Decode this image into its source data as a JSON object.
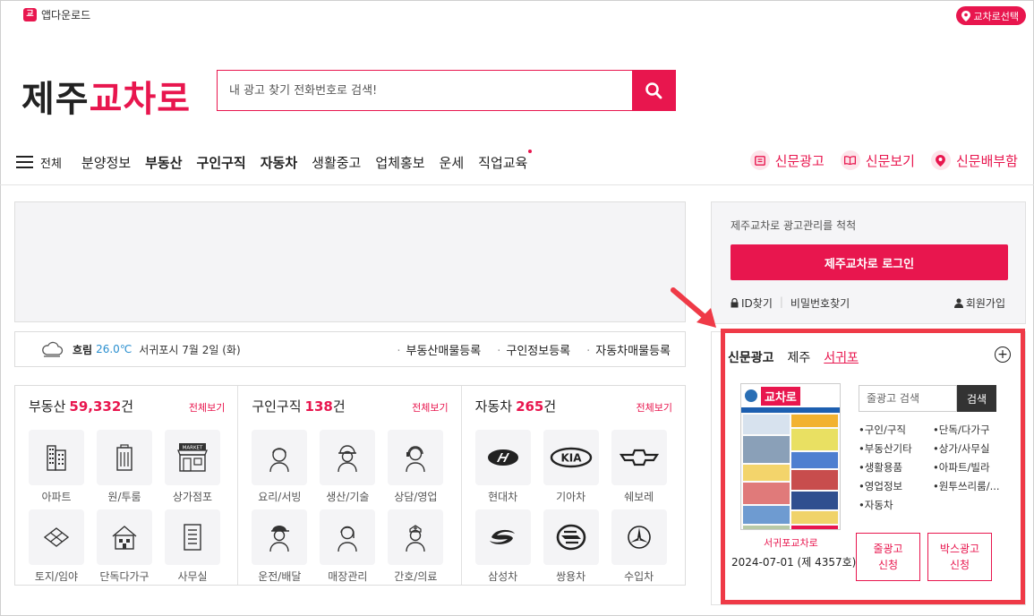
{
  "top": {
    "app_download": "앱다운로드",
    "region_select": "교차로선택"
  },
  "logo": {
    "part1": "제주",
    "part2": "교차로"
  },
  "search": {
    "placeholder": "내 광고 찾기 전화번호로 검색!"
  },
  "nav": {
    "all_label": "전체",
    "items": [
      "분양정보",
      "부동산",
      "구인구직",
      "자동차",
      "생활중고",
      "업체홍보",
      "운세",
      "직업교육"
    ],
    "right": [
      "신문광고",
      "신문보기",
      "신문배부함"
    ]
  },
  "weather": {
    "condition": "흐림",
    "temp": "26.0℃",
    "location_date": "서귀포시 7월 2일 (화)",
    "links": [
      "부동산매물등록",
      "구인정보등록",
      "자동차매물등록"
    ]
  },
  "categories": [
    {
      "title": "부동산",
      "count": "59,332",
      "unit": "건",
      "more": "전체보기",
      "items": [
        "아파트",
        "원/투룸",
        "상가점포",
        "토지/임야",
        "단독다가구",
        "사무실"
      ]
    },
    {
      "title": "구인구직",
      "count": "138",
      "unit": "건",
      "more": "전체보기",
      "items": [
        "요리/서빙",
        "생산/기술",
        "상담/영업",
        "운전/배달",
        "매장관리",
        "간호/의료"
      ]
    },
    {
      "title": "자동차",
      "count": "265",
      "unit": "건",
      "more": "전체보기",
      "items": [
        "현대차",
        "기아차",
        "쉐보레",
        "삼성차",
        "쌍용차",
        "수입차"
      ]
    }
  ],
  "login": {
    "message": "제주교차로 광고관리를 척척",
    "button": "제주교차로 로그인",
    "id_find": "ID찾기",
    "pw_find": "비밀번호찾기",
    "join": "회원가입"
  },
  "newspaper": {
    "tabs": [
      "신문광고",
      "제주",
      "서귀포"
    ],
    "search_placeholder": "줄광고 검색",
    "search_button": "검색",
    "categories": [
      "구인/구직",
      "단독/다가구",
      "부동산기타",
      "상가/사무실",
      "생활용품",
      "아파트/빌라",
      "영업정보",
      "원투쓰리룸/...",
      "자동차"
    ],
    "paper_name": "서귀포교차로",
    "paper_date": "2024-07-01 (제 4357호)",
    "btn_line": [
      "줄광고",
      "신청"
    ],
    "btn_box": [
      "박스광고",
      "신청"
    ],
    "cover_title": "교차로"
  },
  "colors": {
    "accent": "#e8164e",
    "highlight": "#ef3a47"
  }
}
